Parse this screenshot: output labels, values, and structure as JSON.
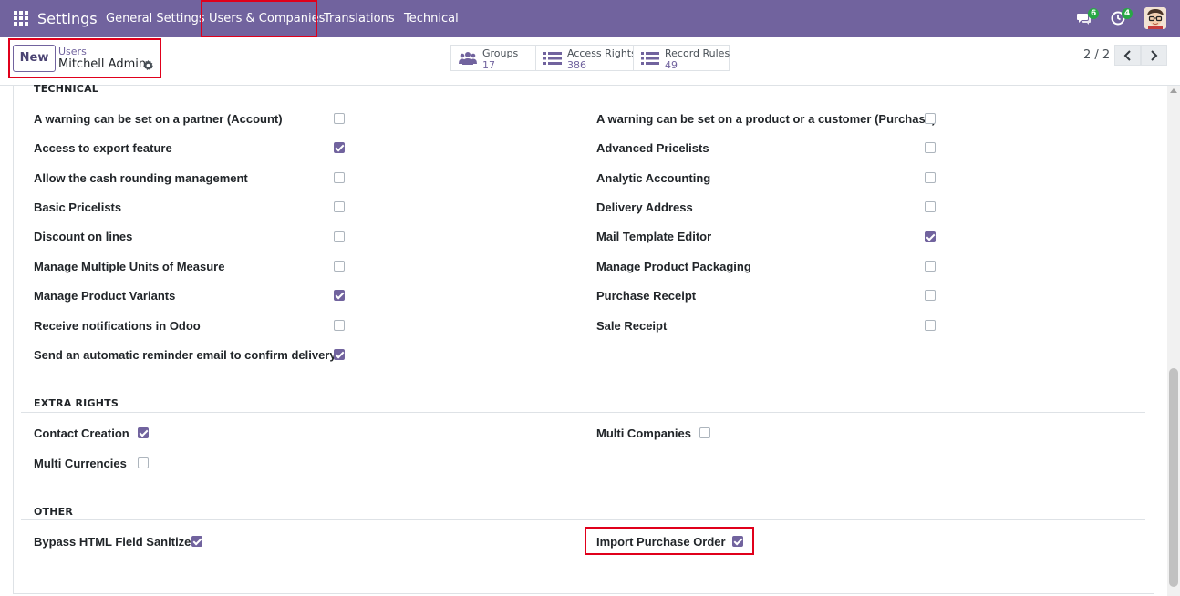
{
  "topbar": {
    "app_name": "Settings",
    "menu": [
      "General Settings",
      "Users & Companies",
      "Translations",
      "Technical"
    ],
    "chat_badge": "6",
    "activity_badge": "4",
    "color": "#71639e"
  },
  "control": {
    "new_label": "New",
    "breadcrumb_parent": "Users",
    "breadcrumb_current": "Mitchell Admin",
    "smart_buttons": [
      {
        "label": "Groups",
        "value": "17",
        "icon": "users-icon"
      },
      {
        "label": "Access Rights",
        "value": "386",
        "icon": "list-icon"
      },
      {
        "label": "Record Rules",
        "value": "49",
        "icon": "list-icon"
      }
    ],
    "pager": "2 / 2"
  },
  "sections": {
    "technical": "TECHNICAL",
    "extra_rights": "EXTRA RIGHTS",
    "other": "OTHER"
  },
  "technical_left": [
    {
      "label": "A warning can be set on a partner (Account)",
      "checked": false
    },
    {
      "label": "Access to export feature",
      "checked": true
    },
    {
      "label": "Allow the cash rounding management",
      "checked": false
    },
    {
      "label": "Basic Pricelists",
      "checked": false
    },
    {
      "label": "Discount on lines",
      "checked": false
    },
    {
      "label": "Manage Multiple Units of Measure",
      "checked": false
    },
    {
      "label": "Manage Product Variants",
      "checked": true
    },
    {
      "label": "Receive notifications in Odoo",
      "checked": false
    },
    {
      "label": "Send an automatic reminder email to confirm delivery",
      "checked": true
    }
  ],
  "technical_right": [
    {
      "label": "A warning can be set on a product or a customer (Purchase)",
      "checked": false
    },
    {
      "label": "Advanced Pricelists",
      "checked": false
    },
    {
      "label": "Analytic Accounting",
      "checked": false
    },
    {
      "label": "Delivery Address",
      "checked": false
    },
    {
      "label": "Mail Template Editor",
      "checked": true
    },
    {
      "label": "Manage Product Packaging",
      "checked": false
    },
    {
      "label": "Purchase Receipt",
      "checked": false
    },
    {
      "label": "Sale Receipt",
      "checked": false
    }
  ],
  "extra_left": [
    {
      "label": "Contact Creation",
      "checked": true
    },
    {
      "label": "Multi Currencies",
      "checked": false
    }
  ],
  "extra_right": [
    {
      "label": "Multi Companies",
      "checked": false
    }
  ],
  "other_left": [
    {
      "label": "Bypass HTML Field Sanitize",
      "checked": true
    }
  ],
  "other_right": [
    {
      "label": "Import Purchase Order",
      "checked": true
    }
  ]
}
